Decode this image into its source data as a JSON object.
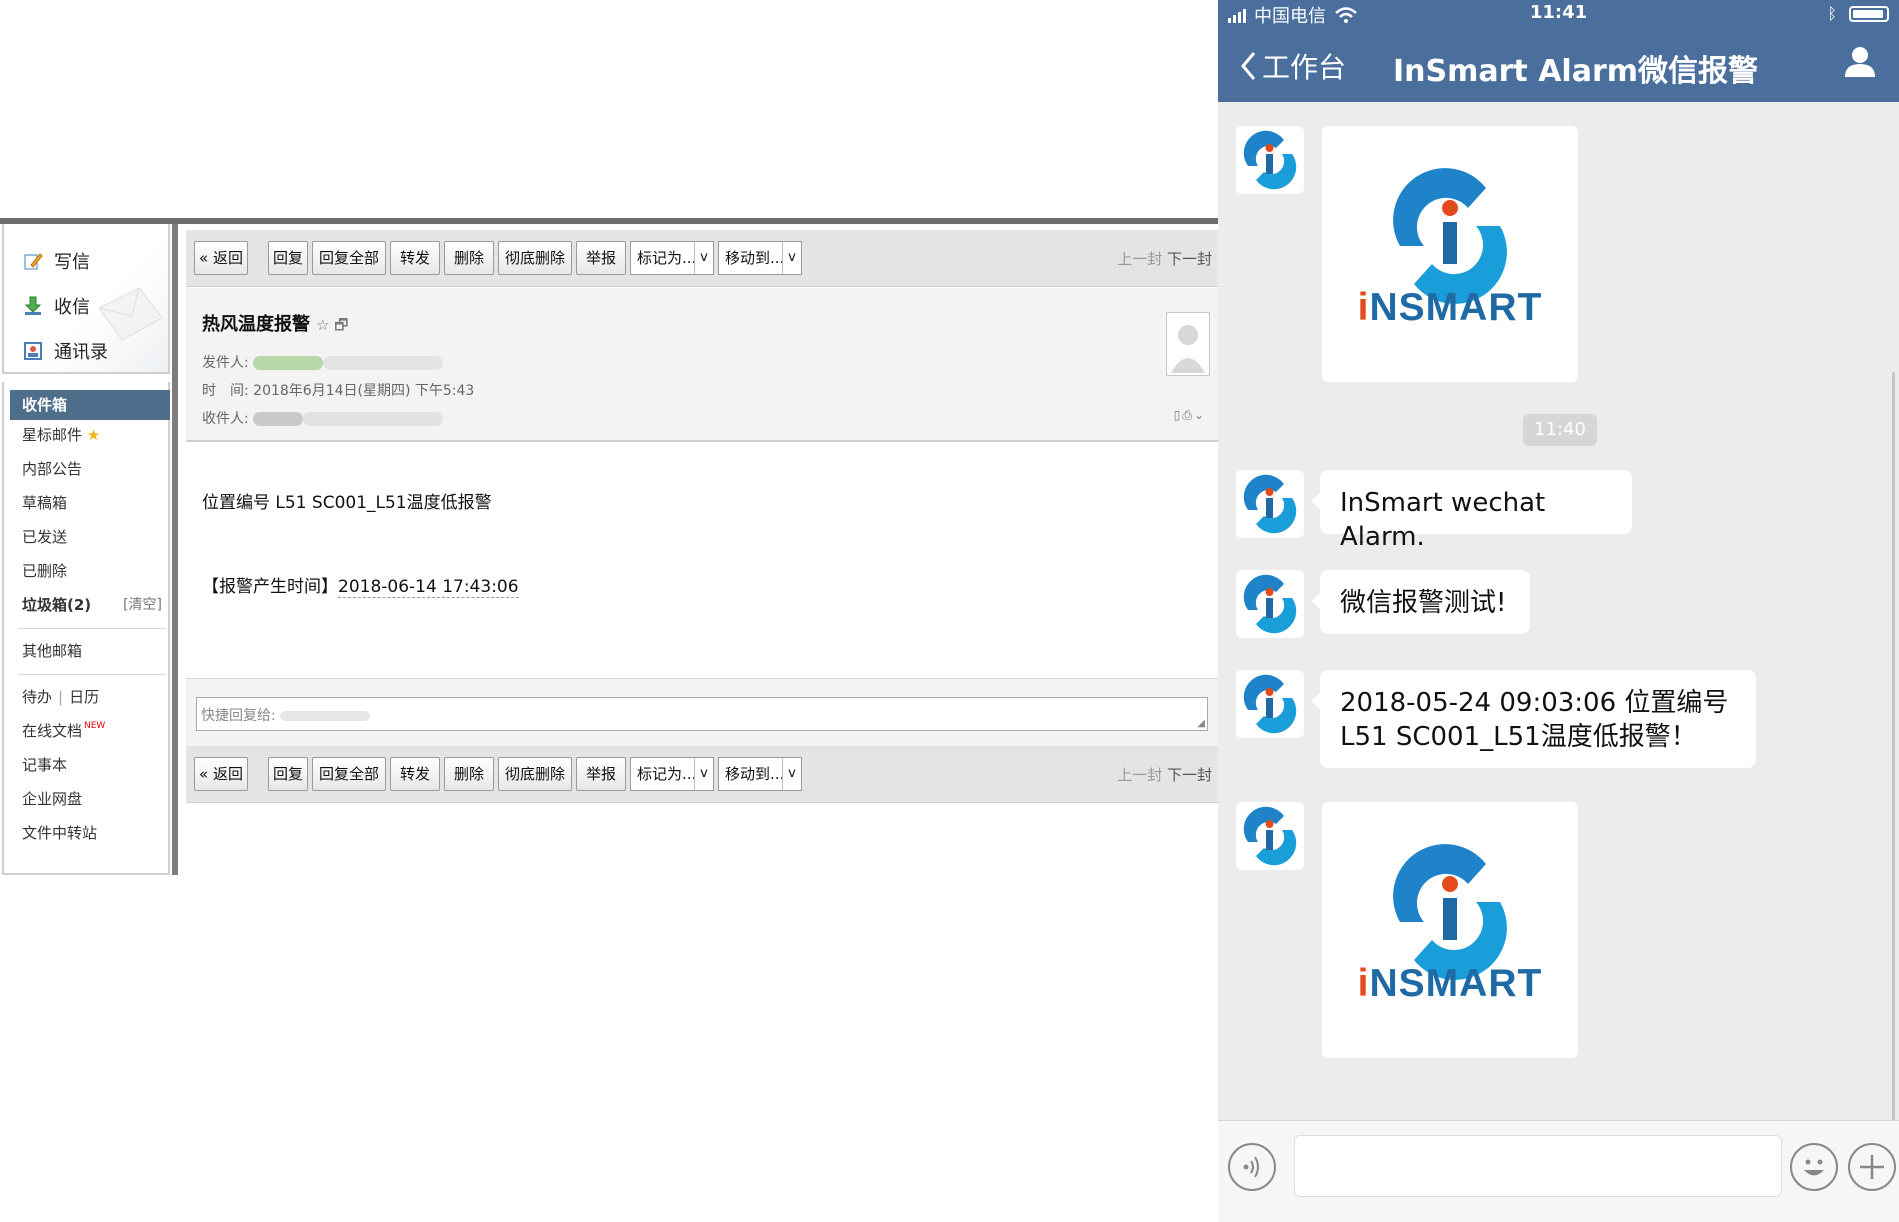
{
  "mail": {
    "quick_actions": {
      "compose": "写信",
      "receive": "收信",
      "contacts": "通讯录"
    },
    "folders": {
      "inbox": "收件箱",
      "starred": "星标邮件",
      "announcements": "内部公告",
      "drafts": "草稿箱",
      "sent": "已发送",
      "deleted": "已删除",
      "spam": "垃圾箱(2)",
      "spam_clear": "[清空]",
      "other": "其他邮箱",
      "todo": "待办",
      "calendar": "日历",
      "online_docs": "在线文档",
      "new_tag": "NEW",
      "notes": "记事本",
      "netdisk": "企业网盘",
      "transfer": "文件中转站"
    },
    "toolbar": {
      "back": "« 返回",
      "reply": "回复",
      "reply_all": "回复全部",
      "forward": "转发",
      "delete": "删除",
      "delete_perm": "彻底删除",
      "report": "举报",
      "mark_as": "标记为...",
      "move_to": "移动到...",
      "prev": "上一封",
      "next": "下一封"
    },
    "message": {
      "subject": "热风温度报警",
      "from_label": "发件人:",
      "time_label": "时　间:",
      "time_value": "2018年6月14日(星期四) 下午5:43",
      "to_label": "收件人:",
      "body_line1": "位置编号 L51 SC001_L51温度低报警",
      "body_line2_prefix": "【报警产生时间】",
      "body_line2_time": "2018-06-14 17:43:06"
    },
    "quick_reply_placeholder": "快捷回复给:"
  },
  "phone": {
    "status": {
      "carrier": "中国电信",
      "time": "11:41"
    },
    "nav": {
      "back": "工作台",
      "title": "InSmart Alarm微信报警"
    },
    "logo_text": "NSMART",
    "time_divider": "11:40",
    "messages": [
      {
        "text": "InSmart wechat Alarm."
      },
      {
        "text": "微信报警测试!"
      },
      {
        "line1": "2018-05-24 09:03:06  位置编号",
        "line2": "L51   SC001_L51温度低报警！"
      }
    ],
    "colors": {
      "navbar": "#4a6f9d",
      "logo_blue": "#1f6aa5",
      "logo_dot": "#e24b1d"
    }
  }
}
